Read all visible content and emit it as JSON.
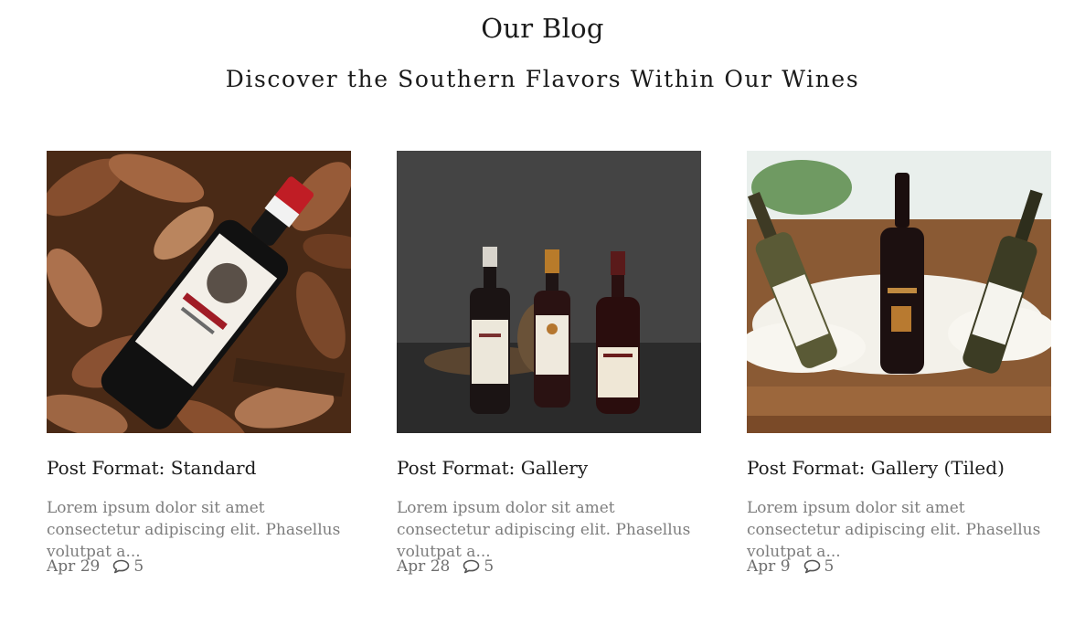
{
  "header": {
    "title": "Our Blog",
    "subtitle": "Discover the Southern Flavors Within Our Wines"
  },
  "posts": [
    {
      "image_icon": "wine-bottle-on-autumn-leaves-photo",
      "title": "Post Format: Standard",
      "excerpt": "Lorem ipsum dolor sit amet consectetur adipiscing elit. Phasellus volutpat a...",
      "date": "Apr 29",
      "comments": "5"
    },
    {
      "image_icon": "three-wine-bottles-dark-photo",
      "title": "Post Format: Gallery",
      "excerpt": "Lorem ipsum dolor sit amet consectetur adipiscing elit. Phasellus volutpat a...",
      "date": "Apr 28",
      "comments": "5"
    },
    {
      "image_icon": "wine-crate-three-bottles-photo",
      "title": "Post Format: Gallery (Tiled)",
      "excerpt": "Lorem ipsum dolor sit amet consectetur adipiscing elit. Phasellus volutpat a...",
      "date": "Apr 9",
      "comments": "5"
    }
  ],
  "colors": {
    "title_text": "#1b1b1b",
    "excerpt_text": "#7d7d7d",
    "meta_text": "#6f6f6f"
  }
}
